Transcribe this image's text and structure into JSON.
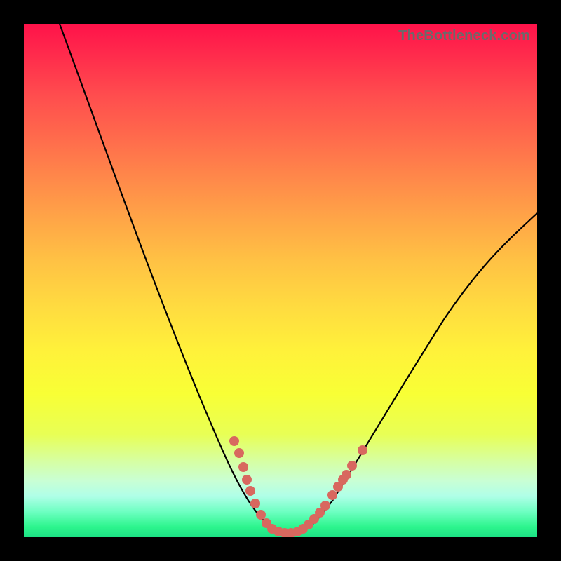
{
  "watermark": "TheBottleneck.com",
  "colors": {
    "frame": "#000000",
    "curve": "#000000",
    "dots": "#d8685f"
  },
  "chart_data": {
    "type": "line",
    "title": "",
    "xlabel": "",
    "ylabel": "",
    "xlim": [
      0,
      100
    ],
    "ylim": [
      0,
      100
    ],
    "grid": false,
    "curve_points": [
      {
        "x": 7,
        "y": 100
      },
      {
        "x": 12,
        "y": 90
      },
      {
        "x": 17,
        "y": 78
      },
      {
        "x": 22,
        "y": 65
      },
      {
        "x": 27,
        "y": 51
      },
      {
        "x": 32,
        "y": 38
      },
      {
        "x": 37,
        "y": 25
      },
      {
        "x": 41,
        "y": 15
      },
      {
        "x": 44,
        "y": 8
      },
      {
        "x": 47,
        "y": 3
      },
      {
        "x": 50,
        "y": 1
      },
      {
        "x": 53,
        "y": 1
      },
      {
        "x": 56,
        "y": 2
      },
      {
        "x": 59,
        "y": 5
      },
      {
        "x": 63,
        "y": 11
      },
      {
        "x": 69,
        "y": 20
      },
      {
        "x": 77,
        "y": 33
      },
      {
        "x": 86,
        "y": 46
      },
      {
        "x": 94,
        "y": 57
      },
      {
        "x": 100,
        "y": 63
      }
    ],
    "scatter_points": [
      {
        "x": 41,
        "y": 19
      },
      {
        "x": 42,
        "y": 15
      },
      {
        "x": 43,
        "y": 12
      },
      {
        "x": 43.5,
        "y": 10
      },
      {
        "x": 44,
        "y": 8
      },
      {
        "x": 45,
        "y": 6
      },
      {
        "x": 46,
        "y": 4
      },
      {
        "x": 47,
        "y": 3
      },
      {
        "x": 48,
        "y": 2
      },
      {
        "x": 49,
        "y": 1.5
      },
      {
        "x": 50,
        "y": 1.2
      },
      {
        "x": 51,
        "y": 1.2
      },
      {
        "x": 52,
        "y": 1.4
      },
      {
        "x": 53,
        "y": 1.6
      },
      {
        "x": 54,
        "y": 2
      },
      {
        "x": 55,
        "y": 2.5
      },
      {
        "x": 56,
        "y": 3.2
      },
      {
        "x": 57,
        "y": 4.2
      },
      {
        "x": 58,
        "y": 5.5
      },
      {
        "x": 60,
        "y": 8
      },
      {
        "x": 61,
        "y": 9.5
      },
      {
        "x": 62,
        "y": 11
      },
      {
        "x": 62.8,
        "y": 12
      },
      {
        "x": 64,
        "y": 14
      },
      {
        "x": 66,
        "y": 17
      }
    ]
  }
}
